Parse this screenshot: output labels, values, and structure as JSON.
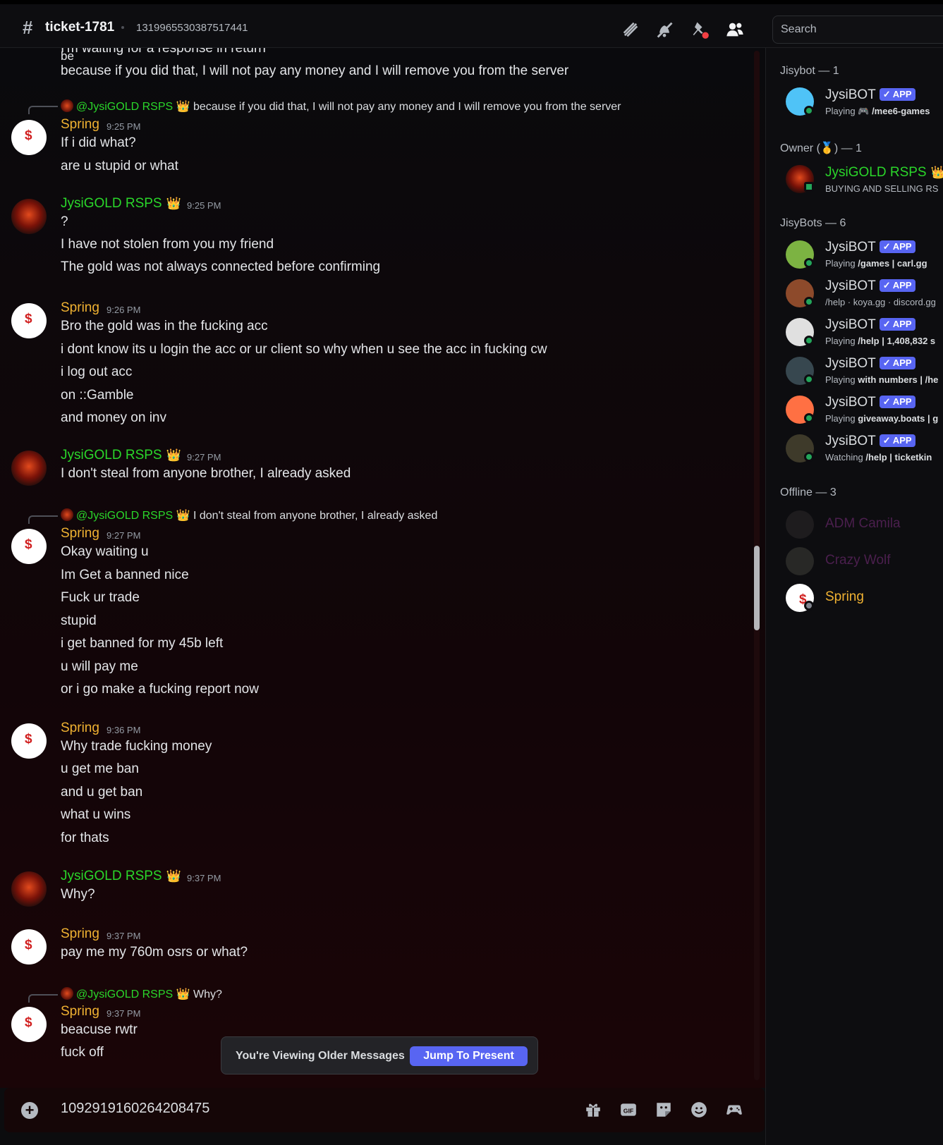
{
  "header": {
    "channel_name": "ticket-1781",
    "topic": "1319965530387517441",
    "search_placeholder": "Search",
    "icons": [
      "threads-icon",
      "mute-notifications-icon",
      "pinned-messages-icon",
      "member-list-icon"
    ]
  },
  "chat": {
    "partial_top_line": "I'm waiting for a response in return",
    "partial_top_line2": "be",
    "messages": [
      {
        "text": "because if you did that, I will not pay any money and I will remove you from the server"
      },
      {
        "reply": {
          "mention": "@JysiGOLD RSPS",
          "crown": "👑",
          "text": "because if you did that, I will not pay any money and I will remove you from the server"
        }
      },
      {
        "author": "Spring",
        "time": "9:25 PM",
        "lines": [
          "If i did what?",
          "are u stupid or what"
        ]
      },
      {
        "author": "JysiGOLD RSPS",
        "crown": "👑",
        "time": "9:25 PM",
        "lines": [
          "?",
          "I have not stolen from you my friend",
          "The gold was not always connected before confirming"
        ]
      },
      {
        "author": "Spring",
        "time": "9:26 PM",
        "lines": [
          "Bro the gold was in the fucking acc",
          "i dont know its u login the acc or ur client so why when u see the acc in fucking cw",
          "i log out acc",
          "on ::Gamble",
          "and money on inv"
        ]
      },
      {
        "author": "JysiGOLD RSPS",
        "crown": "👑",
        "time": "9:27 PM",
        "lines": [
          "I don't steal from anyone brother, I already asked"
        ]
      },
      {
        "reply": {
          "mention": "@JysiGOLD RSPS",
          "crown": "👑",
          "text": "I don't steal from anyone brother, I already asked"
        }
      },
      {
        "author": "Spring",
        "time": "9:27 PM",
        "lines": [
          "Okay waiting u",
          "Im Get a banned nice",
          "Fuck ur trade",
          "stupid",
          "i get banned for my 45b left",
          "u will pay me",
          "or i go make a fucking report now"
        ]
      },
      {
        "author": "Spring",
        "time": "9:36 PM",
        "lines": [
          "Why trade fucking money",
          "u get me ban",
          "and u get ban",
          "what u wins",
          "for thats"
        ]
      },
      {
        "author": "JysiGOLD RSPS",
        "crown": "👑",
        "time": "9:37 PM",
        "lines": [
          "Why?"
        ]
      },
      {
        "author": "Spring",
        "time": "9:37 PM",
        "lines": [
          "pay me my 760m osrs or what?"
        ]
      },
      {
        "reply": {
          "mention": "@JysiGOLD RSPS",
          "crown": "👑",
          "text": "Why?"
        }
      },
      {
        "author": "Spring",
        "time": "9:37 PM",
        "lines": [
          "beacuse rwtr",
          "fuck off"
        ]
      }
    ],
    "older_banner": {
      "text": "You're Viewing Older Messages",
      "button": "Jump To Present"
    }
  },
  "composer": {
    "value": "1092919160264208475",
    "icons": [
      "add-icon",
      "gift-icon",
      "gif-icon",
      "sticker-icon",
      "emoji-icon",
      "activity-icon"
    ]
  },
  "members": {
    "sections": [
      {
        "title": "Jisybot — 1",
        "items": [
          {
            "name": "JysiBOT",
            "badge": "✓ APP",
            "activity_prefix": "Playing",
            "activity": "🎮 /mee6-games",
            "color": "#4fc3f7",
            "status": "online"
          }
        ]
      },
      {
        "title": "Owner (🥇) — 1",
        "items": [
          {
            "name": "JysiGOLD RSPS",
            "crown": "👑",
            "activity": "BUYING AND SELLING RS",
            "status": "mobile"
          }
        ]
      },
      {
        "title": "JisyBots — 6",
        "items": [
          {
            "name": "JysiBOT",
            "badge": "✓ APP",
            "activity_prefix": "Playing",
            "activity": "/games | carl.gg",
            "color": "#7cb342",
            "status": "online"
          },
          {
            "name": "JysiBOT",
            "badge": "✓ APP",
            "activity_prefix": "",
            "activity": "/help · koya.gg · discord.gg",
            "color": "#8d4a2b",
            "status": "online"
          },
          {
            "name": "JysiBOT",
            "badge": "✓ APP",
            "activity_prefix": "Playing",
            "activity": "/help | 1,408,832 s",
            "color": "#e0e0e0",
            "status": "online"
          },
          {
            "name": "JysiBOT",
            "badge": "✓ APP",
            "activity_prefix": "Playing",
            "activity": "with numbers | /he",
            "color": "#37474f",
            "status": "online"
          },
          {
            "name": "JysiBOT",
            "badge": "✓ APP",
            "activity_prefix": "Playing",
            "activity": "giveaway.boats | g",
            "color": "#ff7043",
            "status": "online"
          },
          {
            "name": "JysiBOT",
            "badge": "✓ APP",
            "activity_prefix": "Watching",
            "activity": "/help | ticketkin",
            "color": "#3e3a2a",
            "status": "online"
          }
        ]
      },
      {
        "title": "Offline — 3",
        "items": [
          {
            "name": "ADM Camila",
            "status": "offline"
          },
          {
            "name": "Crazy Wolf",
            "status": "offline"
          },
          {
            "name": "Spring",
            "status": "offline"
          }
        ]
      }
    ]
  },
  "colors": {
    "spring_name": "#f0b232",
    "jysi_name": "#2ad62a",
    "app_badge": "#5865f2",
    "online": "#23a55a"
  }
}
